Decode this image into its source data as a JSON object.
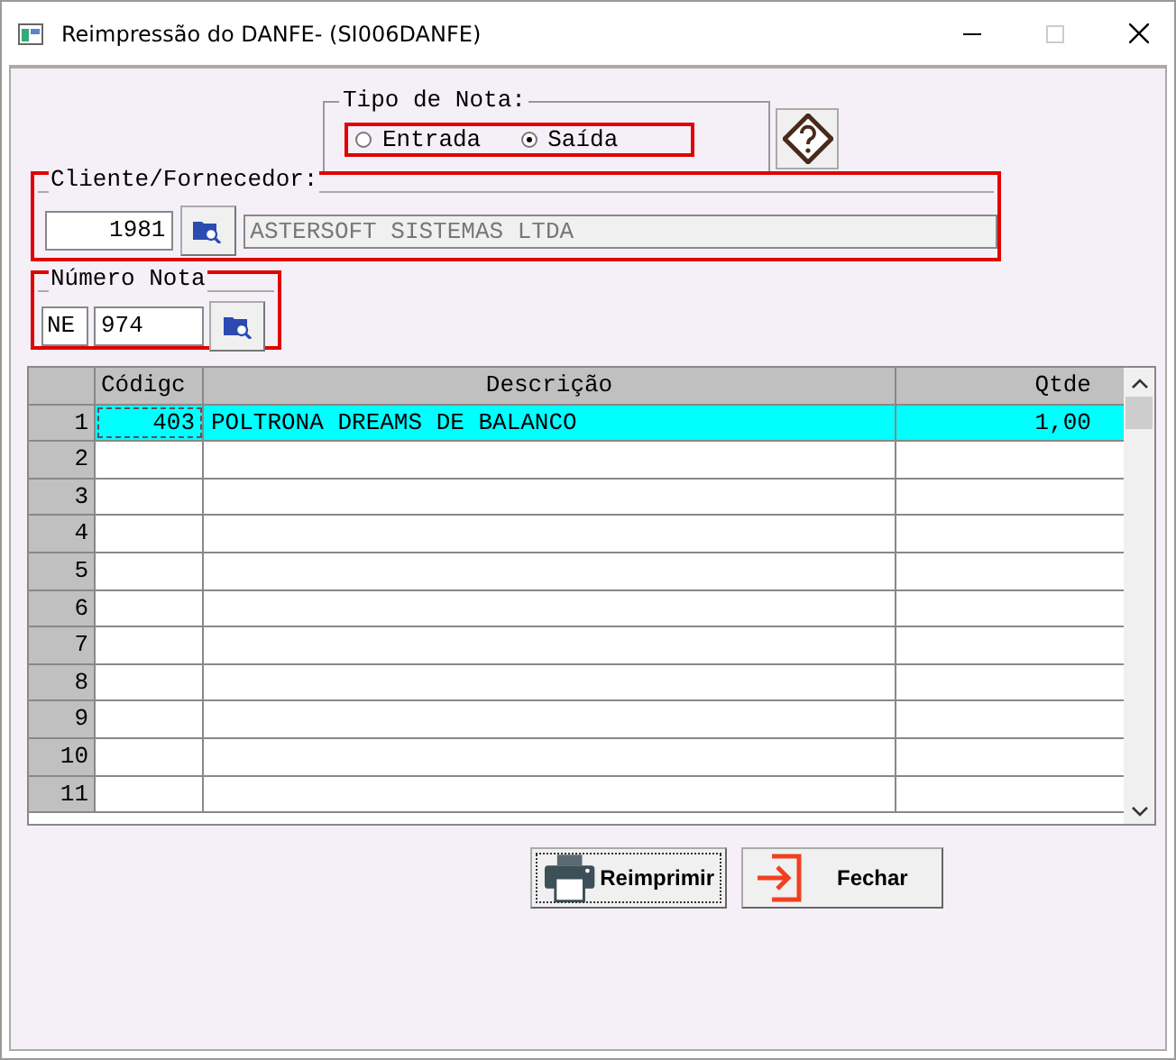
{
  "window": {
    "title": "Reimpressão do DANFE- (SI006DANFE)"
  },
  "tipo_nota": {
    "label": "Tipo de Nota:",
    "options": [
      {
        "label": "Entrada",
        "selected": false
      },
      {
        "label": "Saída",
        "selected": true
      }
    ]
  },
  "cliente": {
    "label": "Cliente/Fornecedor:",
    "code": "1981",
    "name": "ASTERSOFT SISTEMAS LTDA"
  },
  "numero_nota": {
    "label": "Número Nota",
    "series": "NE",
    "number": "974"
  },
  "table": {
    "columns": [
      "Códigc",
      "Descrição",
      "Qtde"
    ],
    "rows": [
      {
        "number": "1",
        "codigo": "403",
        "descricao": "POLTRONA DREAMS DE BALANCO",
        "qtde": "1,00",
        "selected": true
      },
      {
        "number": "2",
        "selected": false
      },
      {
        "number": "3",
        "selected": false
      },
      {
        "number": "4",
        "selected": false
      },
      {
        "number": "5",
        "selected": false
      },
      {
        "number": "6",
        "selected": false
      },
      {
        "number": "7",
        "selected": false
      },
      {
        "number": "8",
        "selected": false
      },
      {
        "number": "9",
        "selected": false
      },
      {
        "number": "10",
        "selected": false
      },
      {
        "number": "11",
        "selected": false
      }
    ]
  },
  "buttons": [
    {
      "kind": "print",
      "label": "Reimprimir",
      "focused": true
    },
    {
      "kind": "exit",
      "label": "Fechar",
      "focused": false
    }
  ]
}
